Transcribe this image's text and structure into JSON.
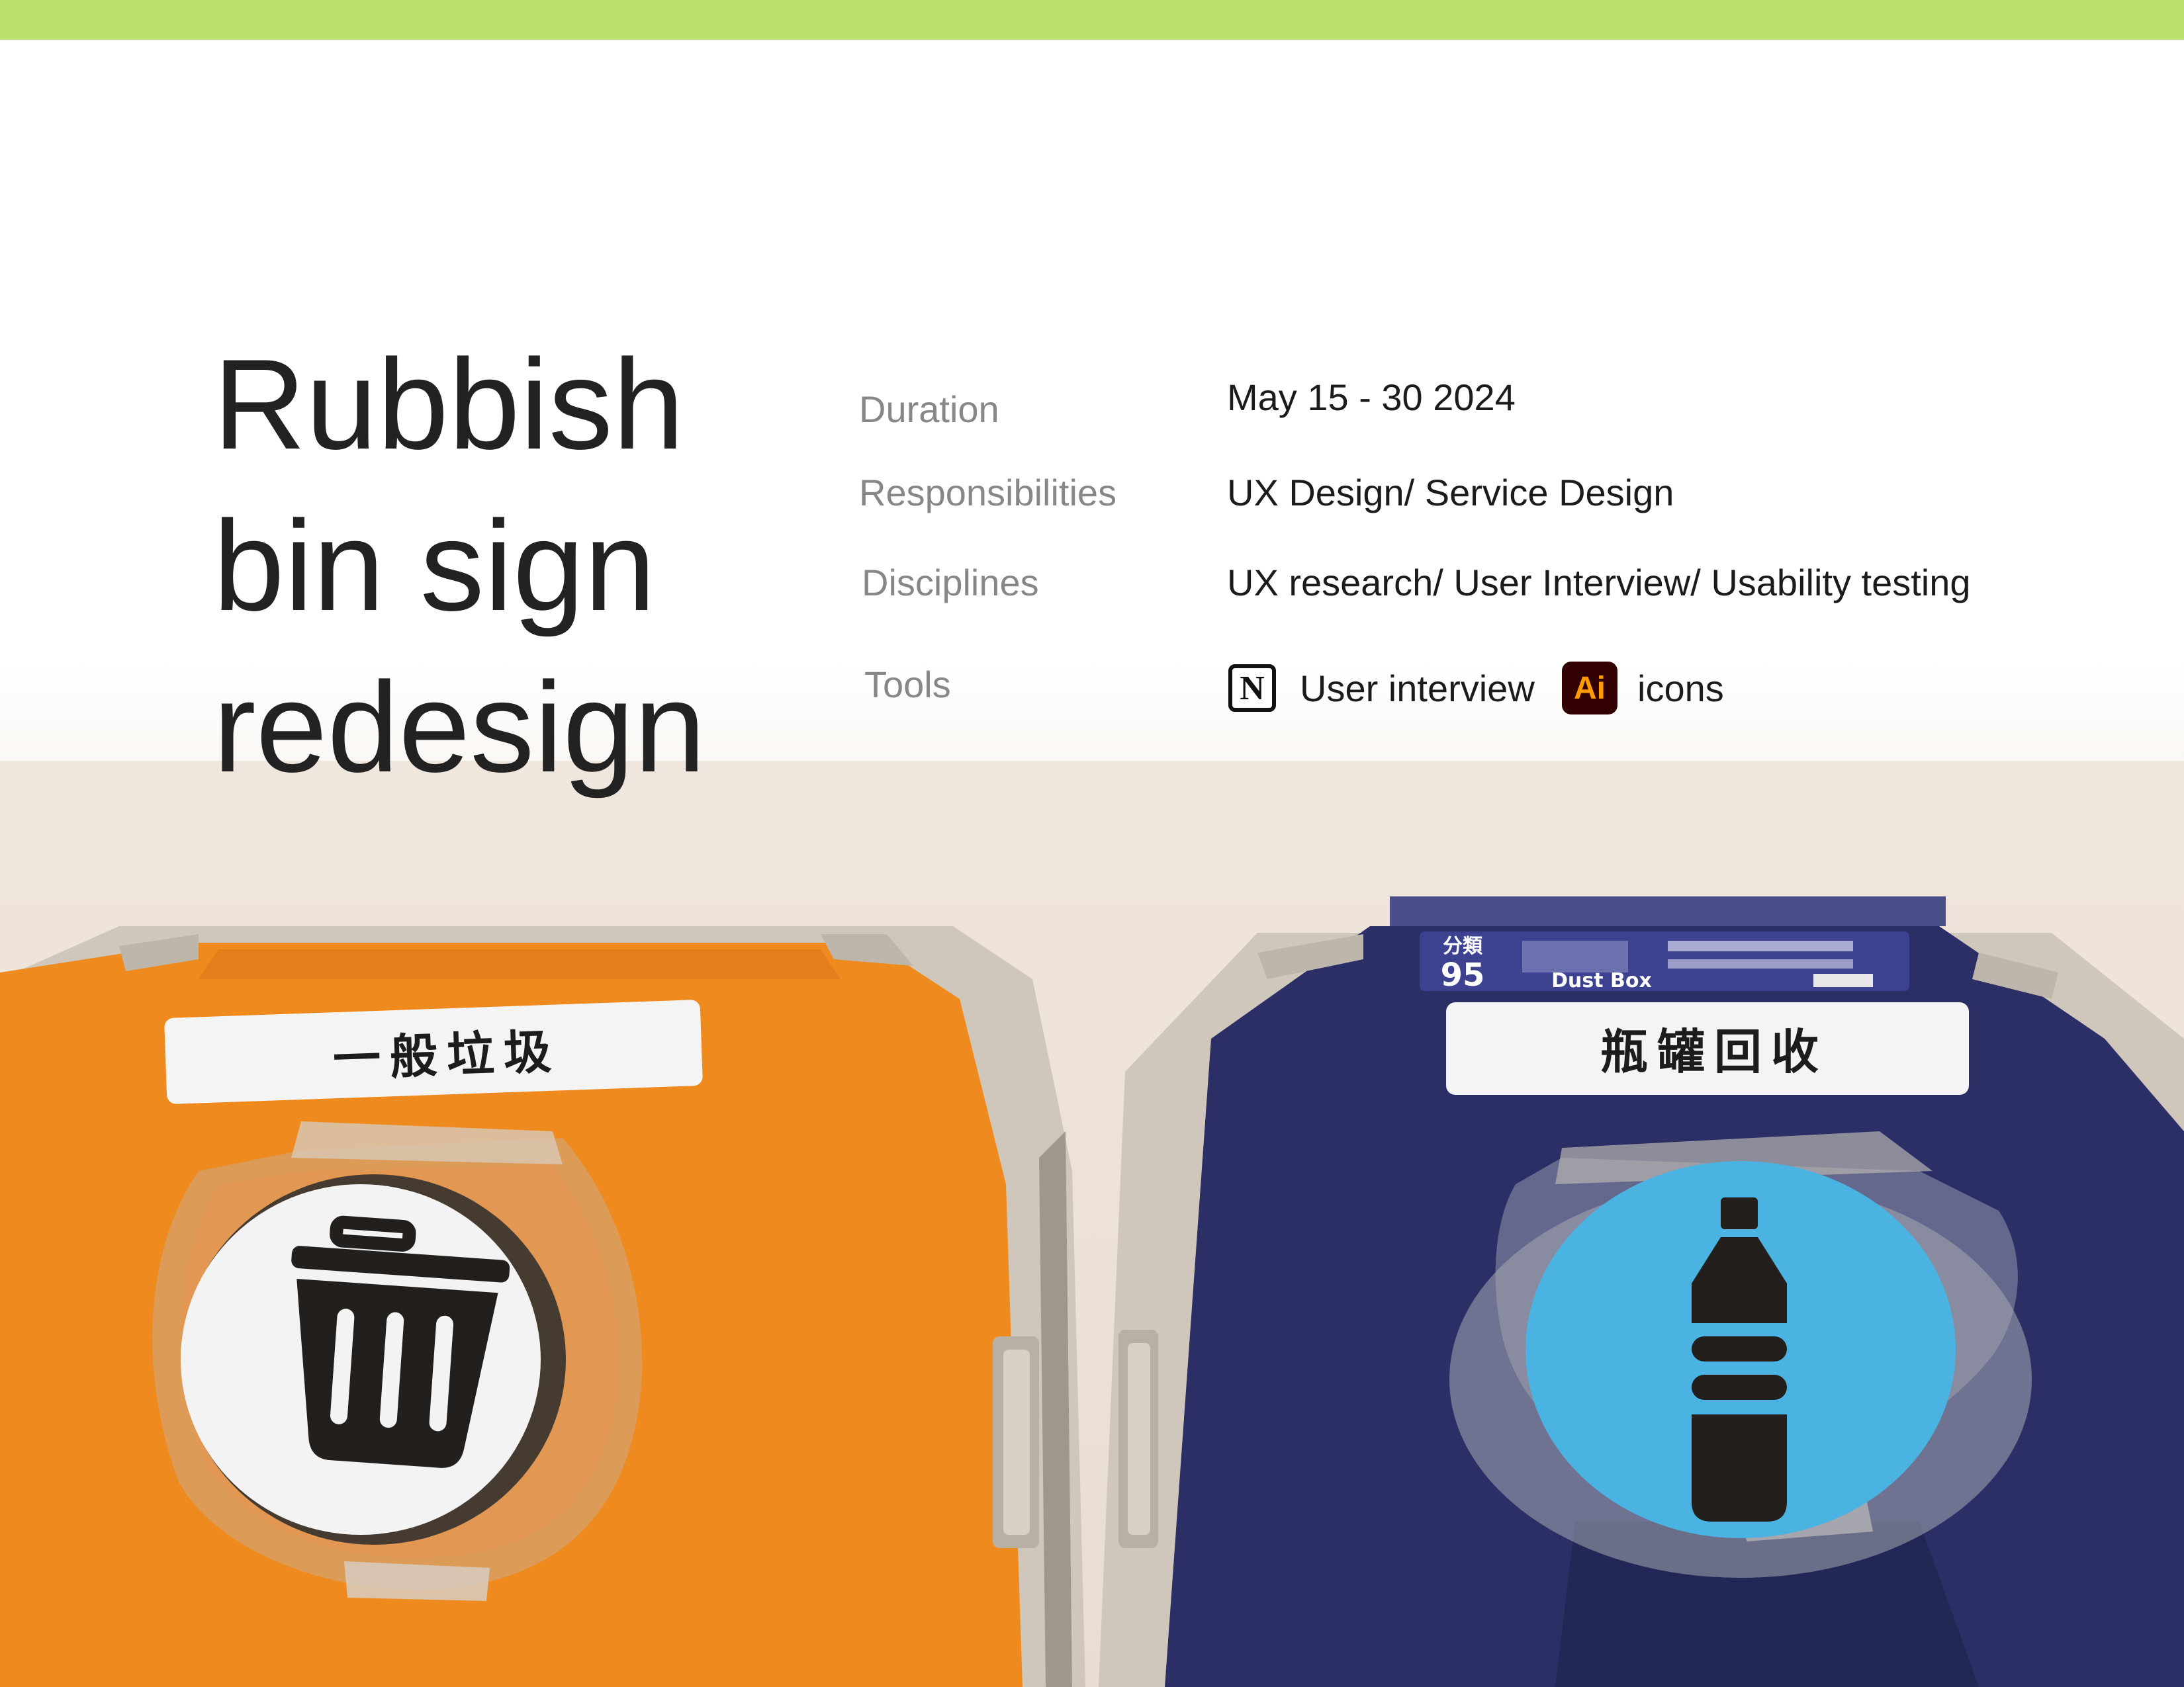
{
  "title": [
    "Rubbish",
    "bin sign",
    "redesign"
  ],
  "meta": {
    "duration": {
      "label": "Duration",
      "value": "May 15 - 30 2024"
    },
    "responsibilities": {
      "label": "Responsibilities",
      "value": "UX Design/ Service Design"
    },
    "disciplines": {
      "label": "Disciplines",
      "value": "UX research/ User Interview/ Usability testing"
    },
    "tools": {
      "label": "Tools",
      "items": [
        {
          "icon": "notion-icon",
          "glyph": "N",
          "label": "User interview"
        },
        {
          "icon": "illustrator-icon",
          "glyph": "Ai",
          "label": "icons"
        }
      ]
    }
  },
  "photo": {
    "left_bin_sign": "一般垃圾",
    "right_bin_sign": "瓶罐回收",
    "right_bin_sticker": {
      "price": "95",
      "category": "分類",
      "brand": "Dust Box"
    }
  },
  "colors": {
    "accent_bar": "#b9e06d",
    "left_bin": "#ef8a1e",
    "right_bin": "#2b2f66",
    "bottle_disc": "#4ab3e2"
  }
}
